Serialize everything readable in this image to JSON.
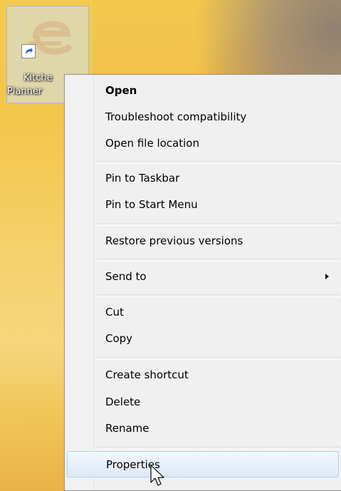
{
  "desktop": {
    "shortcut": {
      "label_line1": "Kitche",
      "label_line2": "Planner",
      "icon": "kitchen-planner-icon"
    }
  },
  "context_menu": {
    "items": [
      {
        "label": "Open",
        "bold": true
      },
      {
        "label": "Troubleshoot compatibility"
      },
      {
        "label": "Open file location"
      },
      {
        "label": "Pin to Taskbar"
      },
      {
        "label": "Pin to Start Menu"
      },
      {
        "label": "Restore previous versions"
      },
      {
        "label": "Send to",
        "has_submenu": true
      },
      {
        "label": "Cut"
      },
      {
        "label": "Copy"
      },
      {
        "label": "Create shortcut"
      },
      {
        "label": "Delete"
      },
      {
        "label": "Rename"
      },
      {
        "label": "Properties",
        "highlighted": true
      }
    ]
  },
  "colors": {
    "menu_bg": "#f0f0f0",
    "highlight_border": "#aecff7",
    "wallpaper_yellow": "#f3c64c"
  }
}
